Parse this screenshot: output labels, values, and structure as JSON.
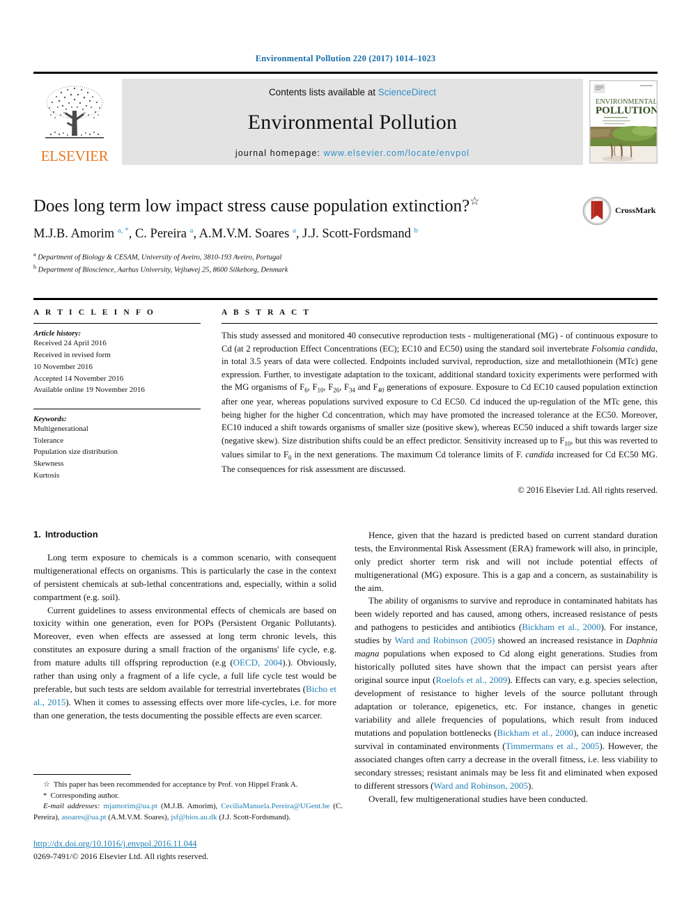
{
  "running_head": "Environmental Pollution 220 (2017) 1014–1023",
  "journal_header": {
    "publisher": "ELSEVIER",
    "contents_prefix": "Contents lists available at ",
    "contents_link": "ScienceDirect",
    "journal_title": "Environmental Pollution",
    "homepage_prefix": "journal homepage: ",
    "homepage_url": "www.elsevier.com/locate/envpol",
    "cover_line1": "ENVIRONMENTAL",
    "cover_line2": "POLLUTION",
    "link_color": "#2f8fc9"
  },
  "article": {
    "title": "Does long term low impact stress cause population extinction?",
    "title_symbol": "☆",
    "authors_html": "M.J.B. Amorim <sup>a, *</sup>, C. Pereira <sup>a</sup>, A.M.V.M. Soares <sup>a</sup>, J.J. Scott-Fordsmand <sup>b</sup>",
    "affiliations": [
      {
        "marker": "a",
        "text": "Department of Biology & CESAM, University of Aveiro, 3810-193 Aveiro, Portugal"
      },
      {
        "marker": "b",
        "text": "Department of Bioscience, Aarhus University, Vejlsøvej 25, 8600 Silkeborg, Denmark"
      }
    ],
    "crossmark_label": "CrossMark"
  },
  "article_info": {
    "heading": "A R T I C L E   I N F O",
    "history_label": "Article history:",
    "history": [
      "Received 24 April 2016",
      "Received in revised form",
      "10 November 2016",
      "Accepted 14 November 2016",
      "Available online 19 November 2016"
    ],
    "keywords_label": "Keywords:",
    "keywords": [
      "Multigenerational",
      "Tolerance",
      "Population size distribution",
      "Skewness",
      "Kurtosis"
    ]
  },
  "abstract": {
    "heading": "A B S T R A C T",
    "body_html": "This study assessed and monitored 40 consecutive reproduction tests - multigenerational (MG) - of continuous exposure to Cd (at 2 reproduction Effect Concentrations (EC); EC10 and EC50) using the standard soil invertebrate <i>Folsomia candida</i>, in total 3.5 years of data were collected. Endpoints included survival, reproduction, size and metallothionein (MTc) gene expression. Further, to investigate adaptation to the toxicant, additional standard toxicity experiments were performed with the MG organisms of F<sub>6</sub>, F<sub>10</sub>, F<sub>26</sub>, F<sub>34</sub> and F<sub>40</sub> generations of exposure. Exposure to Cd EC10 caused population extinction after one year, whereas populations survived exposure to Cd EC50. Cd induced the up-regulation of the MTc gene, this being higher for the higher Cd concentration, which may have promoted the increased tolerance at the EC50. Moreover, EC10 induced a shift towards organisms of smaller size (positive skew), whereas EC50 induced a shift towards larger size (negative skew). Size distribution shifts could be an effect predictor. Sensitivity increased up to F<sub>10</sub>, but this was reverted to values similar to F<sub>0</sub> in the next generations. The maximum Cd tolerance limits of F. <i>candida</i> increased for Cd EC50 MG. The consequences for risk assessment are discussed.",
    "copyright": "© 2016 Elsevier Ltd. All rights reserved."
  },
  "sections": {
    "intro_number": "1.",
    "intro_title": "Introduction"
  },
  "body": {
    "left_paragraphs_html": [
      "Long term exposure to chemicals is a common scenario, with consequent multigenerational effects on organisms. This is particularly the case in the context of persistent chemicals at sub-lethal concentrations and, especially, within a solid compartment (e.g. soil).",
      "Current guidelines to assess environmental effects of chemicals are based on toxicity within one generation, even for POPs (Persistent Organic Pollutants). Moreover, even when effects are assessed at long term chronic levels, this constitutes an exposure during a small fraction of the organisms' life cycle, e.g. from mature adults till offspring reproduction (e.g (<span class=\"ref\">OECD, 2004</span>).). Obviously, rather than using only a fragment of a life cycle, a full life cycle test would be preferable, but such tests are seldom available for terrestrial invertebrates (<span class=\"ref\">Bicho et al., 2015</span>). When it comes to assessing effects over more life-cycles, i.e. for more than one generation, the tests documenting the possible effects are even scarcer."
    ],
    "right_paragraphs_html": [
      "Hence, given that the hazard is predicted based on current standard duration tests, the Environmental Risk Assessment (ERA) framework will also, in principle, only predict shorter term risk and will not include potential effects of multigenerational (MG) exposure. This is a gap and a concern, as sustainability is the aim.",
      "The ability of organisms to survive and reproduce in contaminated habitats has been widely reported and has caused, among others, increased resistance of pests and pathogens to pesticides and antibiotics (<span class=\"ref\">Bickham et al., 2000</span>). For instance, studies by <span class=\"ref\">Ward and Robinson (2005)</span> showed an increased resistance in <i>Daphnia magna</i> populations when exposed to Cd along eight generations. Studies from historically polluted sites have shown that the impact can persist years after original source input (<span class=\"ref\">Roelofs et al., 2009</span>). Effects can vary, e.g. species selection, development of resistance to higher levels of the source pollutant through adaptation or tolerance, epigenetics, etc. For instance, changes in genetic variability and allele frequencies of populations, which result from induced mutations and population bottlenecks (<span class=\"ref\">Bickham et al., 2000</span>), can induce increased survival in contaminated environments (<span class=\"ref\">Timmermans et al., 2005</span>). However, the associated changes often carry a decrease in the overall fitness, i.e. less viability to secondary stresses; resistant animals may be less fit and eliminated when exposed to different stressors (<span class=\"ref\">Ward and Robinson, 2005</span>).",
      "Overall, few multigenerational studies have been conducted."
    ]
  },
  "footnotes": {
    "star_marker": "☆",
    "star_text": "This paper has been recommended for acceptance by Prof. von Hippel Frank A.",
    "corr_marker": "*",
    "corr_text": "Corresponding author.",
    "email_label": "E-mail addresses:",
    "email_html": "<span class=\"ref\">mjamorim@ua.pt</span> (M.J.B. Amorim), <span class=\"ref\">CeciliaManuela.Pereira@UGent.be</span> (C. Pereira), <span class=\"ref\">asoares@ua.pt</span> (A.M.V.M. Soares), <span class=\"ref\">jsf@bios.au.dk</span> (J.J. Scott-Fordsmand).",
    "doi": "http://dx.doi.org/10.1016/j.envpol.2016.11.044",
    "issn": "0269-7491/© 2016 Elsevier Ltd. All rights reserved."
  }
}
